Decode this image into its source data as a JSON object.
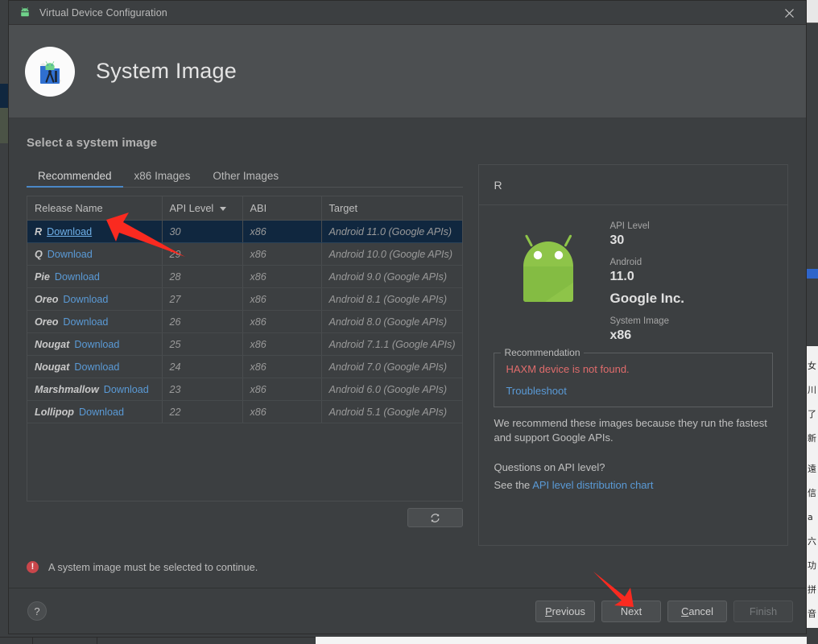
{
  "window": {
    "title": "Virtual Device Configuration",
    "close_icon": "close-icon",
    "app_icon": "android-icon"
  },
  "header": {
    "title": "System Image",
    "logo_icon": "android-studio-logo"
  },
  "main": {
    "section_title": "Select a system image",
    "tabs": [
      {
        "label": "Recommended",
        "active": true
      },
      {
        "label": "x86 Images",
        "active": false
      },
      {
        "label": "Other Images",
        "active": false
      }
    ],
    "table": {
      "columns": [
        "Release Name",
        "API Level",
        "ABI",
        "Target"
      ],
      "sorted_column": "API Level",
      "sort_caret": "chevron-down-icon",
      "rows": [
        {
          "release": "R",
          "action": "Download",
          "api": "30",
          "abi": "x86",
          "target": "Android 11.0 (Google APIs)",
          "selected": true
        },
        {
          "release": "Q",
          "action": "Download",
          "api": "29",
          "abi": "x86",
          "target": "Android 10.0 (Google APIs)",
          "selected": false
        },
        {
          "release": "Pie",
          "action": "Download",
          "api": "28",
          "abi": "x86",
          "target": "Android 9.0 (Google APIs)",
          "selected": false
        },
        {
          "release": "Oreo",
          "action": "Download",
          "api": "27",
          "abi": "x86",
          "target": "Android 8.1 (Google APIs)",
          "selected": false
        },
        {
          "release": "Oreo",
          "action": "Download",
          "api": "26",
          "abi": "x86",
          "target": "Android 8.0 (Google APIs)",
          "selected": false
        },
        {
          "release": "Nougat",
          "action": "Download",
          "api": "25",
          "abi": "x86",
          "target": "Android 7.1.1 (Google APIs)",
          "selected": false
        },
        {
          "release": "Nougat",
          "action": "Download",
          "api": "24",
          "abi": "x86",
          "target": "Android 7.0 (Google APIs)",
          "selected": false
        },
        {
          "release": "Marshmallow",
          "action": "Download",
          "api": "23",
          "abi": "x86",
          "target": "Android 6.0 (Google APIs)",
          "selected": false
        },
        {
          "release": "Lollipop",
          "action": "Download",
          "api": "22",
          "abi": "x86",
          "target": "Android 5.1 (Google APIs)",
          "selected": false
        }
      ]
    },
    "refresh_button": {
      "icon": "refresh-icon",
      "label": ""
    }
  },
  "details": {
    "heading": "R",
    "droid_icon": "android-robot-icon",
    "specs": [
      {
        "label": "API Level",
        "value": "30"
      },
      {
        "label": "Android",
        "value": "11.0"
      }
    ],
    "vendor": "Google Inc.",
    "system_image_label": "System Image",
    "system_image_value": "x86",
    "recommendation": {
      "legend": "Recommendation",
      "error": "HAXM device is not found.",
      "link": "Troubleshoot"
    },
    "note": "We recommend these images because they run the fastest and support Google APIs.",
    "question": "Questions on API level?",
    "see_prefix": "See the ",
    "see_link": "API level distribution chart"
  },
  "validation": {
    "icon": "error-icon",
    "message": "A system image must be selected to continue."
  },
  "footer": {
    "help_label": "?",
    "buttons": [
      {
        "name": "previous",
        "pre": "",
        "mnemonic": "P",
        "post": "revious",
        "disabled": false
      },
      {
        "name": "next",
        "pre": "Next",
        "mnemonic": "",
        "post": "",
        "disabled": false
      },
      {
        "name": "cancel",
        "pre": "",
        "mnemonic": "C",
        "post": "ancel",
        "disabled": false
      },
      {
        "name": "finish",
        "pre": "Finish",
        "mnemonic": "",
        "post": "",
        "disabled": true
      }
    ]
  },
  "annotations": {
    "arrow_color": "#fa2a20",
    "arrow1_target": "download-link-row-1",
    "arrow2_target": "next-button"
  },
  "colors": {
    "dialog_bg": "#3c3f41",
    "header_bg": "#4c4f51",
    "accent_blue": "#4a88c7",
    "link_blue": "#5a9ad6",
    "selected_row": "#10273f",
    "error_red": "#e06c6c",
    "android_green": "#8bc34a"
  }
}
